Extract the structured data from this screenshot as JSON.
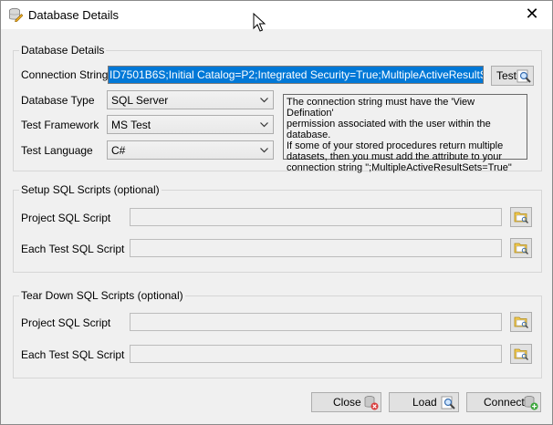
{
  "window": {
    "title": "Database Details"
  },
  "connection": {
    "legend": "Database Details",
    "connection_label": "Connection String",
    "connection_value": "ID7501B6S;Initial Catalog=P2;Integrated Security=True;MultipleActiveResultSets=True",
    "test_label": "Test",
    "db_type_label": "Database Type",
    "db_type_value": "SQL Server",
    "framework_label": "Test Framework",
    "framework_value": "MS Test",
    "language_label": "Test Language",
    "language_value": "C#",
    "info_lines": [
      "The connection string must have the 'View Defination'",
      "permission associated with the user within the database.",
      "If some of your stored procedures return multiple",
      "datasets, then you must add the attribute to your",
      "connection string \";MultipleActiveResultSets=True\""
    ]
  },
  "setup": {
    "legend": "Setup SQL Scripts (optional)",
    "project_label": "Project SQL Script",
    "each_label": "Each Test SQL Script"
  },
  "teardown": {
    "legend": "Tear Down SQL Scripts (optional)",
    "project_label": "Project SQL Script",
    "each_label": "Each Test SQL Script"
  },
  "buttons": {
    "close": "Close",
    "load": "Load",
    "connect": "Connect"
  }
}
